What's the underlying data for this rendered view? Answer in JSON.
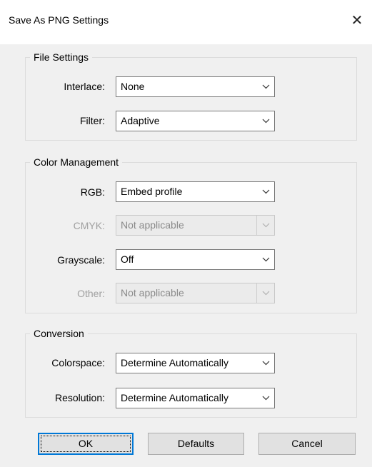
{
  "window": {
    "title": "Save As PNG Settings"
  },
  "file_settings": {
    "legend": "File Settings",
    "interlace": {
      "label": "Interlace:",
      "value": "None"
    },
    "filter": {
      "label": "Filter:",
      "value": "Adaptive"
    }
  },
  "color_management": {
    "legend": "Color Management",
    "rgb": {
      "label": "RGB:",
      "value": "Embed profile"
    },
    "cmyk": {
      "label": "CMYK:",
      "value": "Not applicable",
      "disabled": true
    },
    "grayscale": {
      "label": "Grayscale:",
      "value": "Off"
    },
    "other": {
      "label": "Other:",
      "value": "Not applicable",
      "disabled": true
    }
  },
  "conversion": {
    "legend": "Conversion",
    "colorspace": {
      "label": "Colorspace:",
      "value": "Determine Automatically"
    },
    "resolution": {
      "label": "Resolution:",
      "value": "Determine Automatically"
    }
  },
  "buttons": {
    "ok": "OK",
    "defaults": "Defaults",
    "cancel": "Cancel"
  },
  "icons": {
    "close": "close-icon",
    "dropdown": "chevron-down-icon"
  },
  "colors": {
    "focus_border": "#0078d7",
    "disabled_text": "#a0a0a0"
  }
}
